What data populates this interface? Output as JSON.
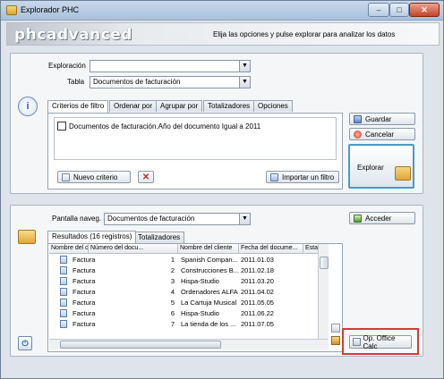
{
  "window": {
    "title": "Explorador PHC",
    "minimize": "–",
    "maximize": "□",
    "close": "✕"
  },
  "banner": {
    "logo": "phcadvanced",
    "instruction": "Elija las opciones y pulse explorar para analizar los datos"
  },
  "top": {
    "exploracion_label": "Exploración",
    "exploracion_value": "",
    "tabla_label": "Tabla",
    "tabla_value": "Documentos de facturación",
    "tabs": [
      "Criterios de filtro",
      "Ordenar por",
      "Agrupar por",
      "Totalizadores",
      "Opciones"
    ],
    "criteria_item": "Documentos de facturación.Año del documento Igual a 2011",
    "nuevo_criterio": "Nuevo criterio",
    "importar_filtro": "Importar un filtro",
    "guardar": "Guardar",
    "cancelar": "Cancelar",
    "explorar": "Explorar"
  },
  "bottom": {
    "pantalla_label": "Pantalla naveg.",
    "pantalla_value": "Documentos de facturación",
    "acceder": "Acceder",
    "tabs": [
      "Resultados (16 registros)",
      "Totalizadores"
    ],
    "columns": [
      "Nombre del docu...",
      "Número del docu...",
      "Nombre del cliente",
      "Fecha del docume...",
      "Estal"
    ],
    "rows": [
      {
        "doc": "Factura",
        "num": "1",
        "cliente": "Spanish Compan...",
        "fecha": "2011.01.03"
      },
      {
        "doc": "Factura",
        "num": "2",
        "cliente": "Construcciones B...",
        "fecha": "2011.02.18"
      },
      {
        "doc": "Factura",
        "num": "3",
        "cliente": "Hispa-Studio",
        "fecha": "2011.03.20"
      },
      {
        "doc": "Factura",
        "num": "4",
        "cliente": "Ordenadores ALFA",
        "fecha": "2011.04.02"
      },
      {
        "doc": "Factura",
        "num": "5",
        "cliente": "La Cartuja Musical",
        "fecha": "2011.05.05"
      },
      {
        "doc": "Factura",
        "num": "6",
        "cliente": "Hispa-Studio",
        "fecha": "2011.06.22"
      },
      {
        "doc": "Factura",
        "num": "7",
        "cliente": "La tienda de los ...",
        "fecha": "2011.07.05"
      }
    ],
    "office_calc": "Op. Office Calc"
  },
  "colors": {
    "highlight_border": "#d23b3b",
    "explore_border": "#4a9bc4"
  }
}
